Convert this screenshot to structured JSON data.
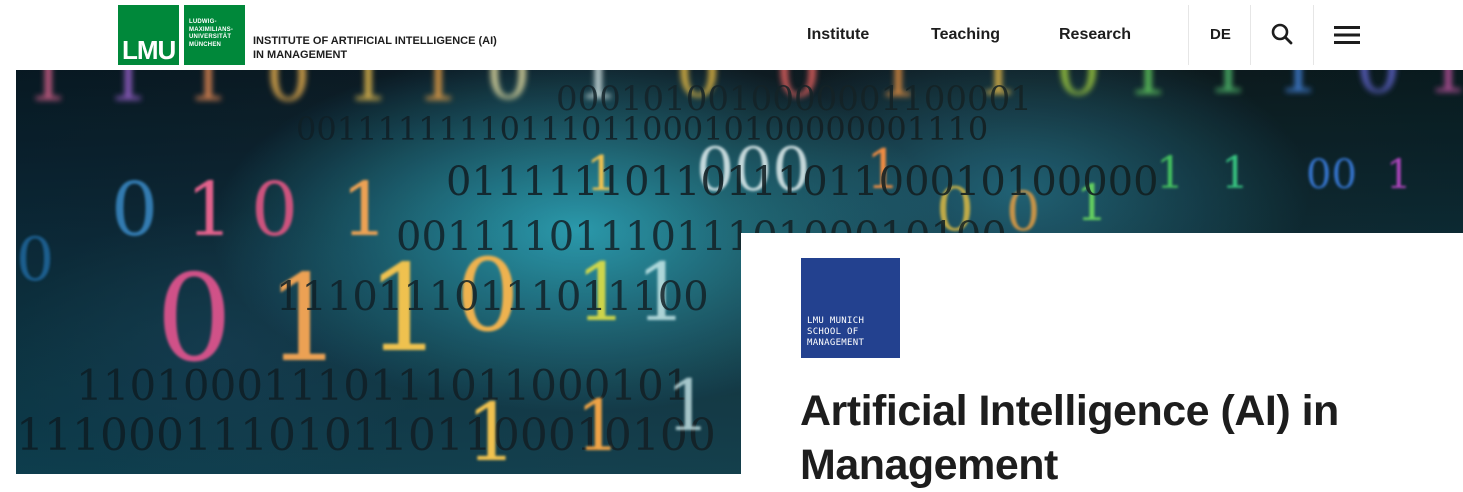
{
  "header": {
    "logo_text": "LMU",
    "university_lines": "LUDWIG-\nMAXIMILIANS-\nUNIVERSITÄT\nMÜNCHEN",
    "institute_line1": "INSTITUTE OF ARTIFICIAL INTELLIGENCE (AI)",
    "institute_line2": "IN MANAGEMENT"
  },
  "nav": {
    "items": [
      {
        "label": "Institute"
      },
      {
        "label": "Teaching"
      },
      {
        "label": "Research"
      }
    ],
    "language": "DE",
    "search_icon": "search-icon",
    "menu_icon": "hamburger-menu-icon"
  },
  "hero": {
    "image": "binary-code-photo"
  },
  "card": {
    "school_logo_text": "LMU MUNICH\nSCHOOL OF\nMANAGEMENT",
    "title": "Artificial Intelligence (AI) in Management"
  },
  "colors": {
    "lmu_green": "#00883a",
    "school_blue": "#23418f",
    "text": "#1d1d1d"
  }
}
